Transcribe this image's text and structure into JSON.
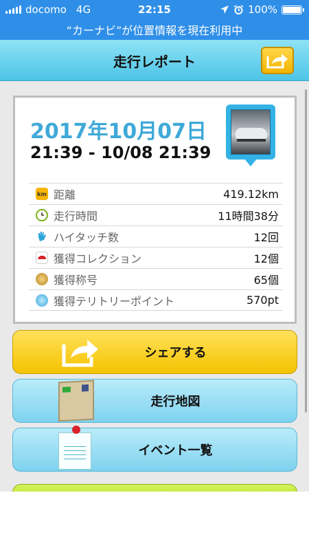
{
  "status_bar": {
    "carrier": "docomo",
    "network": "4G",
    "time": "22:15",
    "battery": "100%",
    "banner": "“カーナビ”が位置情報を現在利用中"
  },
  "header": {
    "title": "走行レポート",
    "share_icon": "share-arrow-icon"
  },
  "report": {
    "date": "2017年10月07日",
    "time_range": "21:39 - 10/08 21:39",
    "stats": [
      {
        "icon": "km-icon",
        "label": "距離",
        "value": "419.12km"
      },
      {
        "icon": "clock-icon",
        "label": "走行時間",
        "value": "11時間38分"
      },
      {
        "icon": "hand-icon",
        "label": "ハイタッチ数",
        "value": "12回"
      },
      {
        "icon": "car-icon",
        "label": "獲得コレクション",
        "value": "12個"
      },
      {
        "icon": "medal-icon",
        "label": "獲得称号",
        "value": "65個"
      },
      {
        "icon": "point-icon",
        "label": "獲得テリトリーポイント",
        "value": "570pt"
      }
    ]
  },
  "buttons": {
    "share": "シェアする",
    "map": "走行地図",
    "events": "イベント一覧"
  },
  "colors": {
    "status_bar": "#2f8fe8",
    "header": "#4cc4e6",
    "date": "#3fa9d8",
    "share_button": "#f5c300",
    "blue_button": "#7fd2ef",
    "green_button": "#b5e02a"
  }
}
